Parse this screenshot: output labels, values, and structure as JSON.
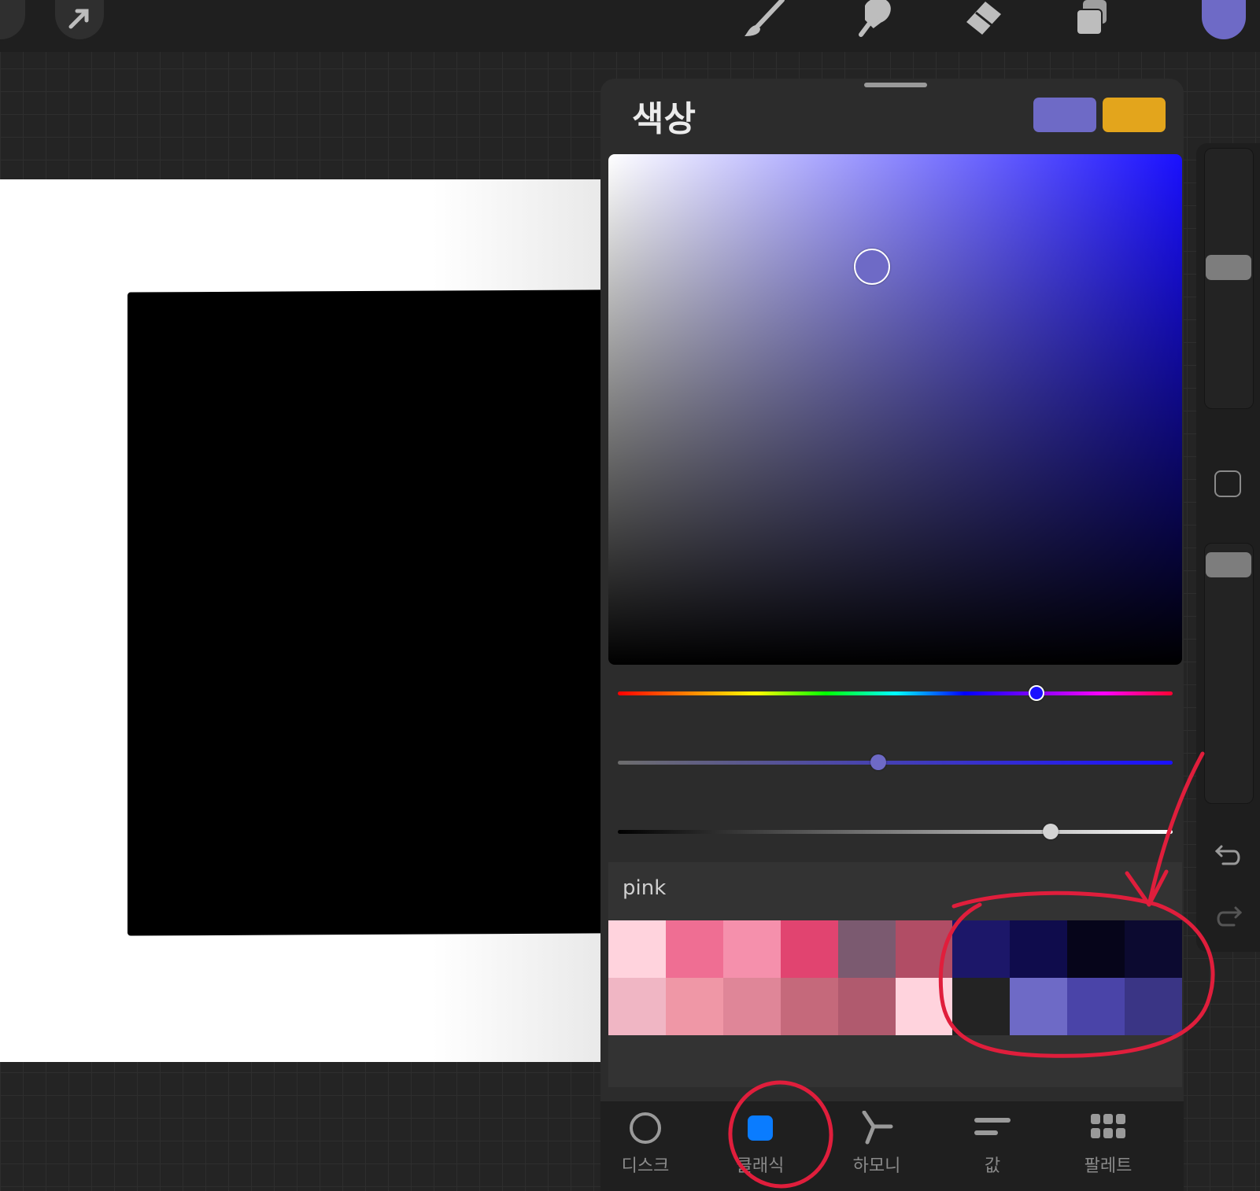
{
  "app": {
    "toolbar": {
      "brush_icon": "brush-icon",
      "smudge_icon": "smudge-icon",
      "eraser_icon": "eraser-icon",
      "layers_icon": "layers-icon",
      "current_color": "#6e6ac6"
    }
  },
  "color_panel": {
    "title": "색상",
    "primary_swatch": "#6e6ac6",
    "secondary_swatch": "#e3a51c",
    "picker": {
      "hue_color": "#1a10ff",
      "selected_saturation": 0.46,
      "selected_brightness": 0.78
    },
    "sliders": {
      "hue": 0.755,
      "saturation": 0.47,
      "brightness": 0.78
    },
    "palette": {
      "name": "pink",
      "colors_row1": [
        "#ffd3dd",
        "#ef6e93",
        "#f590ac",
        "#e14470",
        "#7b5a70",
        "#b14d65",
        "#1c1769",
        "#0f0c4c",
        "#06051a",
        "#0c0a30"
      ],
      "colors_row2": [
        "#f0b6c4",
        "#ef97a6",
        "#df8698",
        "#c5697b",
        "#b05a6e",
        "#ffd3dd",
        "#232323",
        "#6e6ac6",
        "#4a44a8",
        "#3a3585"
      ]
    },
    "tabs": [
      {
        "label": "디스크",
        "icon": "disc-icon"
      },
      {
        "label": "클래식",
        "icon": "classic-icon"
      },
      {
        "label": "하모니",
        "icon": "harmony-icon"
      },
      {
        "label": "값",
        "icon": "value-icon"
      },
      {
        "label": "팔레트",
        "icon": "palette-icon"
      }
    ],
    "active_tab": "클래식"
  },
  "side_rail": {
    "undo_icon": "undo-icon",
    "redo_icon": "redo-icon",
    "modify_icon": "modify-square-icon"
  }
}
